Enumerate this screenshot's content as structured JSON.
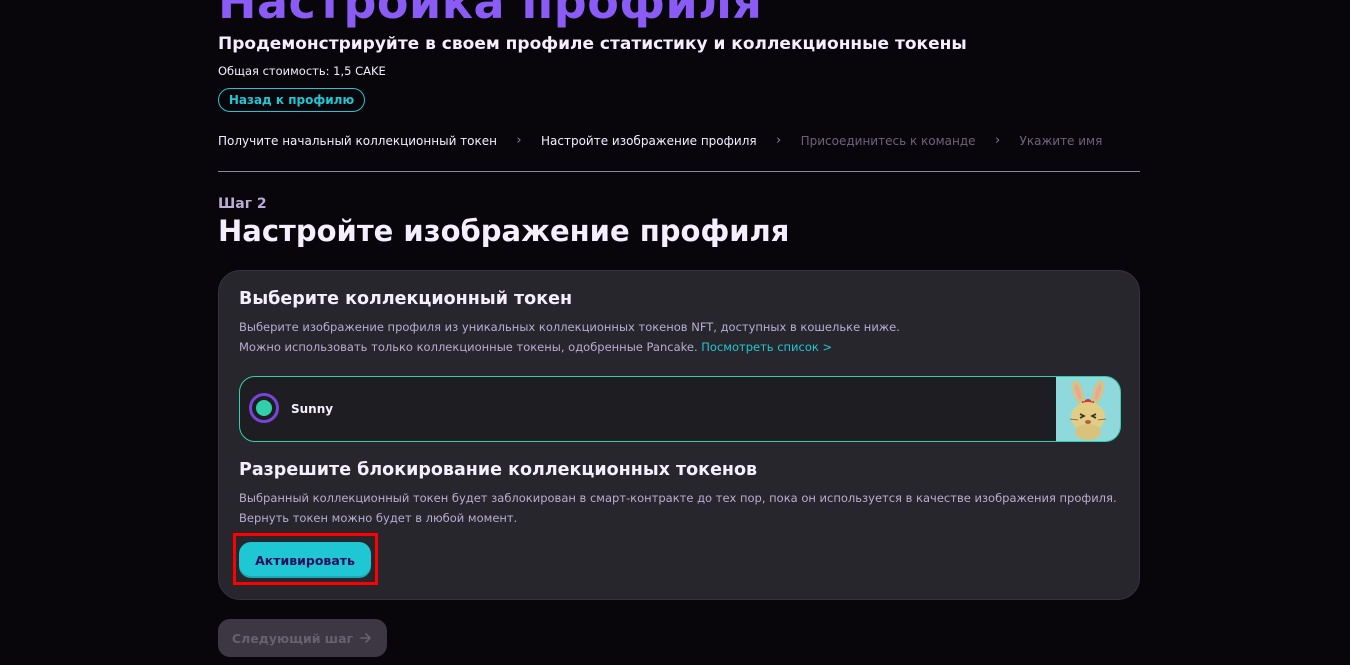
{
  "header": {
    "title": "Настройка профиля",
    "subtitle": "Продемонстрируйте в своем профиле статистику и коллекционные токены",
    "total_cost": "Общая стоимость: 1,5 CAKE",
    "back_button": "Назад к профилю"
  },
  "breadcrumb": [
    {
      "label": "Получите начальный коллекционный токен",
      "state": "done"
    },
    {
      "label": "Настройте изображение профиля",
      "state": "current"
    },
    {
      "label": "Присоединитесь к команде",
      "state": "upcoming"
    },
    {
      "label": "Укажите имя",
      "state": "upcoming"
    }
  ],
  "breadcrumb_separator": "›",
  "step": {
    "label": "Шаг 2",
    "title": "Настройте изображение профиля"
  },
  "card": {
    "choose": {
      "heading": "Выберите коллекционный токен",
      "line1": "Выберите изображение профиля из уникальных коллекционных токенов NFT, доступных в кошельке ниже.",
      "line2": "Можно использовать только коллекционные токены, одобренные Pancake.",
      "link": "Посмотреть список >"
    },
    "nft_option": {
      "name": "Sunny",
      "selected": true,
      "thumbnail_icon": "bunny-nft-image"
    },
    "allow": {
      "heading": "Разрешите блокирование коллекционных токенов",
      "line1": "Выбранный коллекционный токен будет заблокирован в смарт-контракте до тех пор, пока он используется в качестве изображения профиля.",
      "line2": "Вернуть токен можно будет в любой момент."
    },
    "activate_button": "Активировать"
  },
  "next_button": {
    "label": "Следующий шаг",
    "icon": "arrow-right-icon",
    "disabled": true
  },
  "colors": {
    "accent_purple": "#8a5cf5",
    "primary": "#1fc7d4",
    "success": "#31d0aa",
    "card_bg": "#27262c",
    "page_bg": "#08060b",
    "highlight": "#ff0000"
  }
}
